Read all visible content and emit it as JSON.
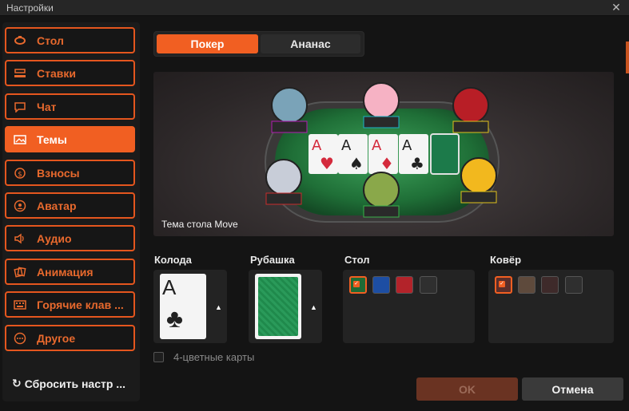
{
  "window": {
    "title": "Настройки"
  },
  "sidebar": {
    "items": [
      {
        "label": "Стол",
        "icon": "table-icon"
      },
      {
        "label": "Ставки",
        "icon": "bets-icon"
      },
      {
        "label": "Чат",
        "icon": "chat-icon"
      },
      {
        "label": "Темы",
        "icon": "themes-icon",
        "active": true
      },
      {
        "label": "Взносы",
        "icon": "fees-icon"
      },
      {
        "label": "Аватар",
        "icon": "avatar-icon"
      },
      {
        "label": "Аудио",
        "icon": "audio-icon"
      },
      {
        "label": "Анимация",
        "icon": "animation-icon"
      },
      {
        "label": "Горячие клав ...",
        "icon": "hotkeys-icon"
      },
      {
        "label": "Другое",
        "icon": "other-icon"
      }
    ],
    "reset_label": "Сбросить настр ..."
  },
  "tabs": [
    {
      "label": "Покер",
      "active": true
    },
    {
      "label": "Ананас",
      "active": false
    }
  ],
  "preview": {
    "caption": "Тема стола Move",
    "board_cards": [
      "A",
      "A",
      "A",
      "A"
    ]
  },
  "sections": {
    "deck": {
      "label": "Колода",
      "card_rank": "A"
    },
    "back": {
      "label": "Рубашка"
    },
    "table": {
      "label": "Стол",
      "colors": [
        "#1f6b35",
        "#1d4ea3",
        "#b3232a",
        "#2f2f2f"
      ],
      "selected": 0
    },
    "carpet": {
      "label": "Ковёр",
      "colors": [
        "#5a2e2a",
        "#5e4a3c",
        "#3e2a2a",
        "#2f2f2f"
      ],
      "selected": 0
    }
  },
  "options": {
    "four_color_label": "4-цветные карты",
    "four_color_checked": false
  },
  "buttons": {
    "ok": "OK",
    "cancel": "Отмена"
  },
  "accent": "#f15f22"
}
